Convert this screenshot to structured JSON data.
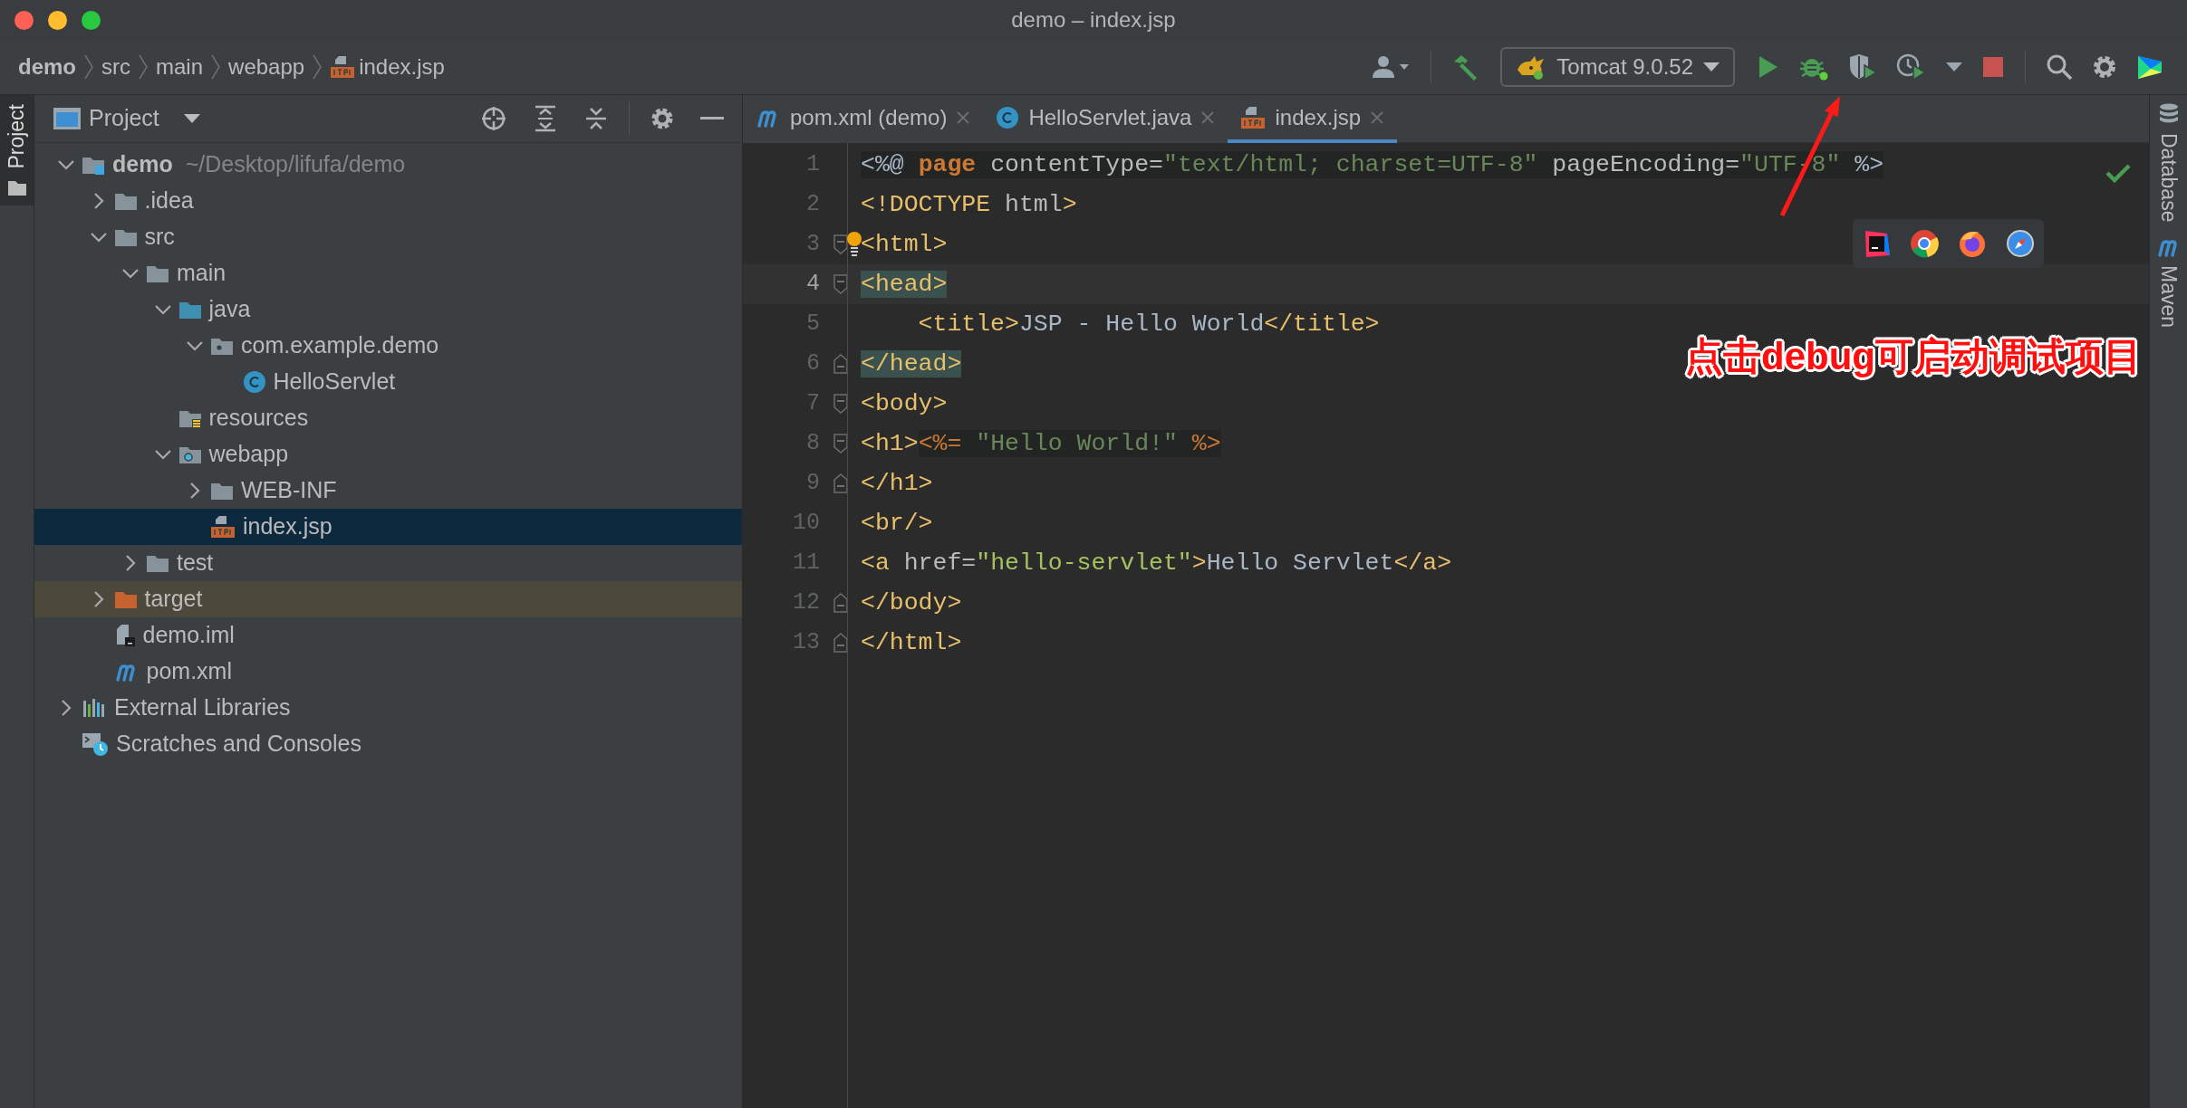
{
  "window": {
    "title": "demo – index.jsp"
  },
  "breadcrumb": [
    {
      "label": "demo",
      "kind": "project"
    },
    {
      "label": "src",
      "kind": "folder"
    },
    {
      "label": "main",
      "kind": "folder"
    },
    {
      "label": "webapp",
      "kind": "folder"
    },
    {
      "label": "index.jsp",
      "kind": "jsp"
    }
  ],
  "run_config": {
    "label": "Tomcat 9.0.52"
  },
  "left_stripe": [
    {
      "label": "Project",
      "selected": true
    }
  ],
  "project_panel": {
    "title": "Project",
    "tree": [
      {
        "label": "demo",
        "detail": "~/Desktop/lifufa/demo",
        "kind": "module",
        "expanded": true,
        "selected": false,
        "children": [
          {
            "label": ".idea",
            "kind": "folder",
            "expanded": false,
            "selected": false
          },
          {
            "label": "src",
            "kind": "folder",
            "expanded": true,
            "selected": false,
            "children": [
              {
                "label": "main",
                "kind": "folder",
                "expanded": true,
                "selected": false,
                "children": [
                  {
                    "label": "java",
                    "kind": "source-folder",
                    "expanded": true,
                    "selected": false,
                    "children": [
                      {
                        "label": "com.example.demo",
                        "kind": "package",
                        "expanded": true,
                        "selected": false,
                        "children": [
                          {
                            "label": "HelloServlet",
                            "kind": "class",
                            "selected": false
                          }
                        ]
                      }
                    ]
                  },
                  {
                    "label": "resources",
                    "kind": "resources",
                    "selected": false
                  },
                  {
                    "label": "webapp",
                    "kind": "web-folder",
                    "expanded": true,
                    "selected": false,
                    "children": [
                      {
                        "label": "WEB-INF",
                        "kind": "folder",
                        "expanded": false,
                        "selected": false
                      },
                      {
                        "label": "index.jsp",
                        "kind": "jsp",
                        "selected": true
                      }
                    ]
                  }
                ]
              },
              {
                "label": "test",
                "kind": "folder",
                "expanded": false,
                "selected": false
              }
            ]
          },
          {
            "label": "target",
            "kind": "excluded-folder",
            "expanded": false,
            "selected": false
          },
          {
            "label": "demo.iml",
            "kind": "iml",
            "selected": false
          },
          {
            "label": "pom.xml",
            "kind": "maven",
            "selected": false
          }
        ]
      },
      {
        "label": "External Libraries",
        "kind": "libraries",
        "expanded": false,
        "selected": false
      },
      {
        "label": "Scratches and Consoles",
        "kind": "scratches",
        "selected": false
      }
    ]
  },
  "editor_tabs": [
    {
      "label": "pom.xml (demo)",
      "kind": "maven",
      "selected": false
    },
    {
      "label": "HelloServlet.java",
      "kind": "class",
      "selected": false
    },
    {
      "label": "index.jsp",
      "kind": "jsp",
      "selected": true
    }
  ],
  "code_lines": [
    {
      "number": "1",
      "current": false,
      "bulb": false,
      "tokens": [
        {
          "kind": "plain",
          "text": "<%@ ",
          "shaded": true
        },
        {
          "kind": "keyword",
          "text": "page",
          "shaded": true
        },
        {
          "kind": "attr",
          "text": " contentType=",
          "shaded": true
        },
        {
          "kind": "string",
          "text": "\"text/html; charset=UTF-8\"",
          "shaded": true
        },
        {
          "kind": "attr",
          "text": " pageEncoding=",
          "shaded": true
        },
        {
          "kind": "string",
          "text": "\"UTF-8\"",
          "shaded": true
        },
        {
          "kind": "plain",
          "text": " %>",
          "shaded": true
        }
      ]
    },
    {
      "number": "2",
      "current": false,
      "bulb": false,
      "tokens": [
        {
          "kind": "tag",
          "text": "<!DOCTYPE "
        },
        {
          "kind": "attr",
          "text": "html"
        },
        {
          "kind": "tag",
          "text": ">"
        }
      ]
    },
    {
      "number": "3",
      "fold_open": true,
      "current": false,
      "bulb": true,
      "tokens": [
        {
          "kind": "tag",
          "text": "<html>"
        }
      ]
    },
    {
      "number": "4",
      "fold_open": true,
      "current": true,
      "bulb": false,
      "tokens": [
        {
          "kind": "tag",
          "text": "<head>",
          "matched": true
        }
      ]
    },
    {
      "number": "5",
      "current": false,
      "bulb": false,
      "tokens": [
        {
          "kind": "tag",
          "text": "    <title>"
        },
        {
          "kind": "plain",
          "text": "JSP - Hello World"
        },
        {
          "kind": "tag",
          "text": "</title>"
        }
      ]
    },
    {
      "number": "6",
      "fold_close": true,
      "current": false,
      "bulb": false,
      "tokens": [
        {
          "kind": "tag",
          "text": "</head>",
          "matched": true
        }
      ]
    },
    {
      "number": "7",
      "fold_open": true,
      "current": false,
      "bulb": false,
      "tokens": [
        {
          "kind": "tag",
          "text": "<body>"
        }
      ]
    },
    {
      "number": "8",
      "fold_open": true,
      "current": false,
      "bulb": false,
      "tokens": [
        {
          "kind": "tag",
          "text": "<h1>"
        },
        {
          "kind": "jsp",
          "text": "<%= ",
          "shaded": true
        },
        {
          "kind": "string",
          "text": "\"Hello World!\"",
          "shaded": true
        },
        {
          "kind": "jsp",
          "text": " %>",
          "shaded": true
        }
      ]
    },
    {
      "number": "9",
      "fold_close": true,
      "current": false,
      "bulb": false,
      "tokens": [
        {
          "kind": "tag",
          "text": "</h1>"
        }
      ]
    },
    {
      "number": "10",
      "current": false,
      "bulb": false,
      "tokens": [
        {
          "kind": "tag",
          "text": "<br/>"
        }
      ]
    },
    {
      "number": "11",
      "current": false,
      "bulb": false,
      "tokens": [
        {
          "kind": "tag",
          "text": "<a "
        },
        {
          "kind": "attr",
          "text": "href="
        },
        {
          "kind": "value",
          "text": "\"hello-servlet\""
        },
        {
          "kind": "tag",
          "text": ">"
        },
        {
          "kind": "plain",
          "text": "Hello Servlet"
        },
        {
          "kind": "tag",
          "text": "</a>"
        }
      ]
    },
    {
      "number": "12",
      "fold_close": true,
      "current": false,
      "bulb": false,
      "tokens": [
        {
          "kind": "tag",
          "text": "</body>"
        }
      ]
    },
    {
      "number": "13",
      "fold_close": true,
      "current": false,
      "bulb": false,
      "tokens": [
        {
          "kind": "tag",
          "text": "</html>"
        }
      ]
    }
  ],
  "right_stripe": [
    {
      "label": "Database",
      "kind": "database",
      "selected": false
    },
    {
      "label": "Maven",
      "kind": "maven",
      "selected": false
    }
  ],
  "annotation": {
    "text": "点击debug可启动调试项目"
  }
}
